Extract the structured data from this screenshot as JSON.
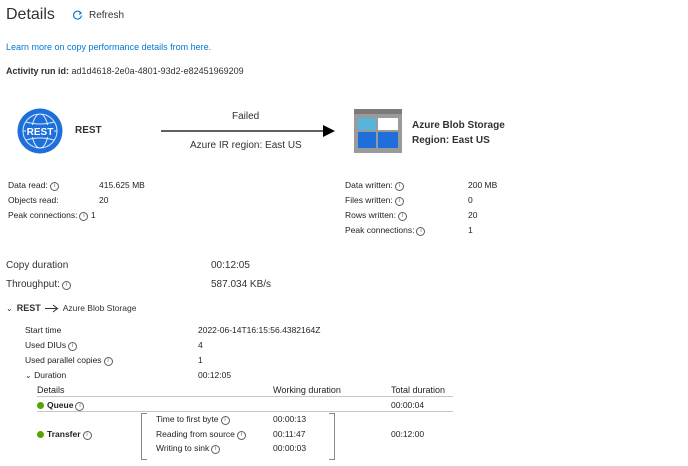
{
  "header": {
    "title": "Details",
    "refresh_label": "Refresh"
  },
  "learn_more_link": "Learn more on copy performance details from here.",
  "activity_run": {
    "label": "Activity run id:",
    "value": "ad1d4618-2e0a-4801-93d2-e82451969209"
  },
  "flow": {
    "source": {
      "badge": "REST",
      "name": "REST"
    },
    "status": "Failed",
    "ir_region": "Azure IR region: East US",
    "sink": {
      "name": "Azure Blob Storage",
      "region": "Region: East US"
    }
  },
  "source_stats": [
    {
      "label": "Data read:",
      "value": "415.625 MB"
    },
    {
      "label": "Objects read:",
      "value": "20"
    },
    {
      "label": "Peak connections:",
      "value": "1"
    }
  ],
  "sink_stats": [
    {
      "label": "Data written:",
      "value": "200 MB"
    },
    {
      "label": "Files written:",
      "value": "0"
    },
    {
      "label": "Rows written:",
      "value": "20"
    },
    {
      "label": "Peak connections:",
      "value": "1"
    }
  ],
  "summary": {
    "copy_duration": {
      "label": "Copy duration",
      "value": "00:12:05"
    },
    "throughput": {
      "label": "Throughput:",
      "value": "587.034 KB/s"
    }
  },
  "section": {
    "source": "REST",
    "sink": "Azure Blob Storage"
  },
  "run_details": [
    {
      "label": "Start time",
      "value": "2022-06-14T16:15:56.4382164Z"
    },
    {
      "label": "Used DIUs",
      "value": "4"
    },
    {
      "label": "Used parallel copies",
      "value": "1"
    }
  ],
  "duration": {
    "label": "Duration",
    "value": "00:12:05",
    "columns": {
      "details": "Details",
      "working": "Working duration",
      "total": "Total duration"
    },
    "queue": {
      "label": "Queue",
      "total": "00:00:04"
    },
    "transfer": {
      "label": "Transfer",
      "total": "00:12:00",
      "steps": [
        {
          "label": "Time to first byte",
          "value": "00:00:13"
        },
        {
          "label": "Reading from source",
          "value": "00:11:47"
        },
        {
          "label": "Writing to sink",
          "value": "00:00:03"
        }
      ]
    }
  },
  "colors": {
    "link": "#0078d4",
    "rest_blue": "#1e6fd9",
    "status_green": "#57a300",
    "text": "#323130"
  }
}
